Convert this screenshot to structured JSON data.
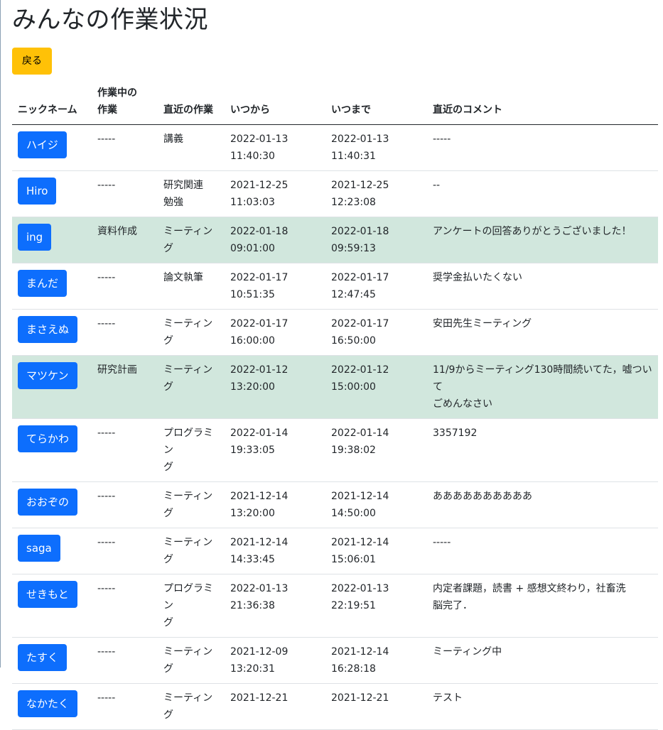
{
  "page": {
    "title": "みんなの作業状況",
    "back_label": "戻る"
  },
  "table": {
    "headers": [
      "ニックネーム",
      "作業中の\n作業",
      "直近の作業",
      "いつから",
      "いつまで",
      "直近のコメント"
    ],
    "rows": [
      {
        "nick": "ハイジ",
        "current": "-----",
        "recent": "講義",
        "from_date": "2022-01-13",
        "from_time": "11:40:30",
        "to_date": "2022-01-13",
        "to_time": "11:40:31",
        "comment": "-----",
        "active": false
      },
      {
        "nick": "Hiro",
        "current": "-----",
        "recent": "研究関連\n勉強",
        "from_date": "2021-12-25",
        "from_time": "11:03:03",
        "to_date": "2021-12-25",
        "to_time": "12:23:08",
        "comment": "--",
        "active": false
      },
      {
        "nick": "ing",
        "current": "資料作成",
        "recent": "ミーティング",
        "from_date": "2022-01-18",
        "from_time": "09:01:00",
        "to_date": "2022-01-18",
        "to_time": "09:59:13",
        "comment": "アンケートの回答ありがとうございました！",
        "active": true
      },
      {
        "nick": "まんだ",
        "current": "-----",
        "recent": "論文執筆",
        "from_date": "2022-01-17",
        "from_time": "10:51:35",
        "to_date": "2022-01-17",
        "to_time": "12:47:45",
        "comment": "奨学金払いたくない",
        "active": false
      },
      {
        "nick": "まさえぬ",
        "current": "-----",
        "recent": "ミーティング",
        "from_date": "2022-01-17",
        "from_time": "16:00:00",
        "to_date": "2022-01-17",
        "to_time": "16:50:00",
        "comment": "安田先生ミーティング",
        "active": false
      },
      {
        "nick": "マツケン",
        "current": "研究計画",
        "recent": "ミーティング",
        "from_date": "2022-01-12",
        "from_time": "13:20:00",
        "to_date": "2022-01-12",
        "to_time": "15:00:00",
        "comment": "11/9からミーティング130時間続いてた，嘘ついて\nごめんなさい",
        "active": true
      },
      {
        "nick": "てらかわ",
        "current": "-----",
        "recent": "プログラミン\nグ",
        "from_date": "2022-01-14",
        "from_time": "19:33:05",
        "to_date": "2022-01-14",
        "to_time": "19:38:02",
        "comment": "3357192",
        "active": false
      },
      {
        "nick": "おおぞの",
        "current": "-----",
        "recent": "ミーティング",
        "from_date": "2021-12-14",
        "from_time": "13:20:00",
        "to_date": "2021-12-14",
        "to_time": "14:50:00",
        "comment": "ああああああああああ",
        "active": false
      },
      {
        "nick": "saga",
        "current": "-----",
        "recent": "ミーティング",
        "from_date": "2021-12-14",
        "from_time": "14:33:45",
        "to_date": "2021-12-14",
        "to_time": "15:06:01",
        "comment": "-----",
        "active": false
      },
      {
        "nick": "せきもと",
        "current": "-----",
        "recent": "プログラミン\nグ",
        "from_date": "2022-01-13",
        "from_time": "21:36:38",
        "to_date": "2022-01-13",
        "to_time": "22:19:51",
        "comment": "内定者課題，読書 + 感想文終わり，社畜洗\n脳完了．",
        "active": false
      },
      {
        "nick": "たすく",
        "current": "-----",
        "recent": "ミーティング",
        "from_date": "2021-12-09",
        "from_time": "13:20:31",
        "to_date": "2021-12-14",
        "to_time": "16:28:18",
        "comment": "ミーティング中",
        "active": false
      },
      {
        "nick": "なかたく",
        "current": "-----",
        "recent": "ミーティング",
        "from_date": "2021-12-21",
        "from_time": "",
        "to_date": "2021-12-21",
        "to_time": "",
        "comment": "テスト",
        "active": false
      }
    ]
  },
  "colors": {
    "nick_button": "#0d6efd",
    "back_button": "#ffc107",
    "active_row": "#d1e7dd"
  }
}
